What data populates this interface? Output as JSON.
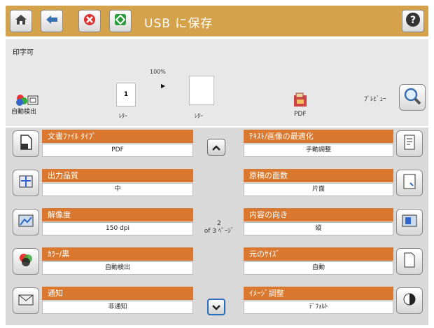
{
  "header": {
    "title": "USB に保存"
  },
  "preview": {
    "title": "印字可",
    "zoom": "100%",
    "page_number": "1",
    "auto_detect_label": "自動検出",
    "paper_left": "ﾚﾀｰ",
    "paper_right": "ﾚﾀｰ",
    "file_type": "PDF",
    "preview_label": "ﾌﾟﾚﾋﾞｭｰ"
  },
  "settings": {
    "left": [
      {
        "label": "文書ﾌｧｲﾙ ﾀｲﾌﾟ",
        "value": "PDF"
      },
      {
        "label": "出力品質",
        "value": "中"
      },
      {
        "label": "解像度",
        "value": "150 dpi"
      },
      {
        "label": "ｶﾗｰ/黒",
        "value": "自動検出"
      },
      {
        "label": "通知",
        "value": "非通知"
      }
    ],
    "right": [
      {
        "label": "ﾃｷｽﾄ/画像の最適化",
        "value": "手動調整"
      },
      {
        "label": "原稿の面数",
        "value": "片面"
      },
      {
        "label": "内容の向き",
        "value": "縦"
      },
      {
        "label": "元のｻｲｽﾞ",
        "value": "自動"
      },
      {
        "label": "ｲﾒｰｼﾞ調整",
        "value": "ﾃﾞﾌｫﾙﾄ"
      }
    ],
    "page_current": "2",
    "page_total": "of 3 ﾍﾟｰｼﾞ"
  },
  "icons": {
    "home": "home-icon",
    "back": "back-icon",
    "stop": "stop-icon",
    "start": "start-icon",
    "help": "help-icon",
    "preview": "magnifier-icon"
  },
  "colors": {
    "topbar": "#d4a24a",
    "label_bar": "#d9782e",
    "stop": "#d33",
    "start": "#2a9a3a"
  }
}
